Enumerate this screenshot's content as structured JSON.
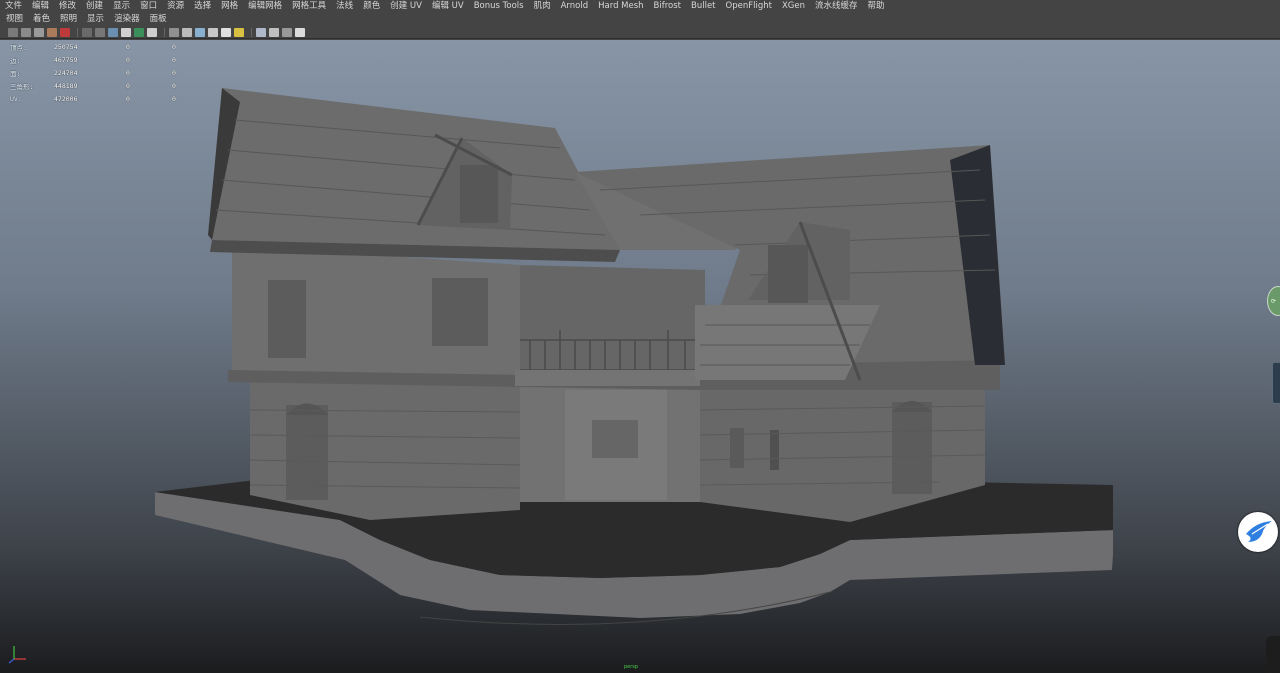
{
  "menu": {
    "items": [
      "文件",
      "编辑",
      "修改",
      "创建",
      "显示",
      "窗口",
      "资源",
      "选择",
      "网格",
      "编辑网格",
      "网格工具",
      "法线",
      "颜色",
      "创建 UV",
      "编辑 UV",
      "Bonus Tools",
      "肌肉",
      "Arnold",
      "Hard Mesh",
      "Bifrost",
      "Bullet",
      "OpenFlight",
      "XGen",
      "流水线缓存",
      "帮助"
    ]
  },
  "panel_menu": {
    "items": [
      "视图",
      "着色",
      "照明",
      "显示",
      "渲染器",
      "面板"
    ]
  },
  "toolbar": {
    "icons": [
      "camera-icon",
      "lock-camera-icon",
      "film-gate-icon",
      "bookmark-icon",
      "image-plane-icon",
      "frame-icon",
      "grid-icon",
      "wireframe-icon",
      "smooth-shade-icon",
      "textured-icon",
      "lights-icon",
      "shadows-icon",
      "ao-icon",
      "aa-icon",
      "isolate-icon",
      "xray-icon",
      "xray-joints-icon",
      "backface-icon",
      "subdiv-icon",
      "gate-icon",
      "resolution-icon"
    ]
  },
  "hud": {
    "rows": [
      {
        "label": "顶点:",
        "v1": "250754",
        "v2": "0",
        "v3": "0"
      },
      {
        "label": "边:",
        "v1": "467759",
        "v2": "0",
        "v3": "0"
      },
      {
        "label": "面:",
        "v1": "224704",
        "v2": "0",
        "v3": "0"
      },
      {
        "label": "三角形:",
        "v1": "448189",
        "v2": "0",
        "v3": "0"
      },
      {
        "label": "UV:",
        "v1": "472006",
        "v2": "0",
        "v3": "0"
      }
    ]
  },
  "viewport": {
    "camera_label": "persp",
    "object": "medieval-house-model"
  },
  "colors": {
    "menubar_bg": "#444444",
    "viewport_top": "#8795a6",
    "viewport_bottom": "#1b1c1e",
    "model_gray": "#6e6e6e"
  }
}
